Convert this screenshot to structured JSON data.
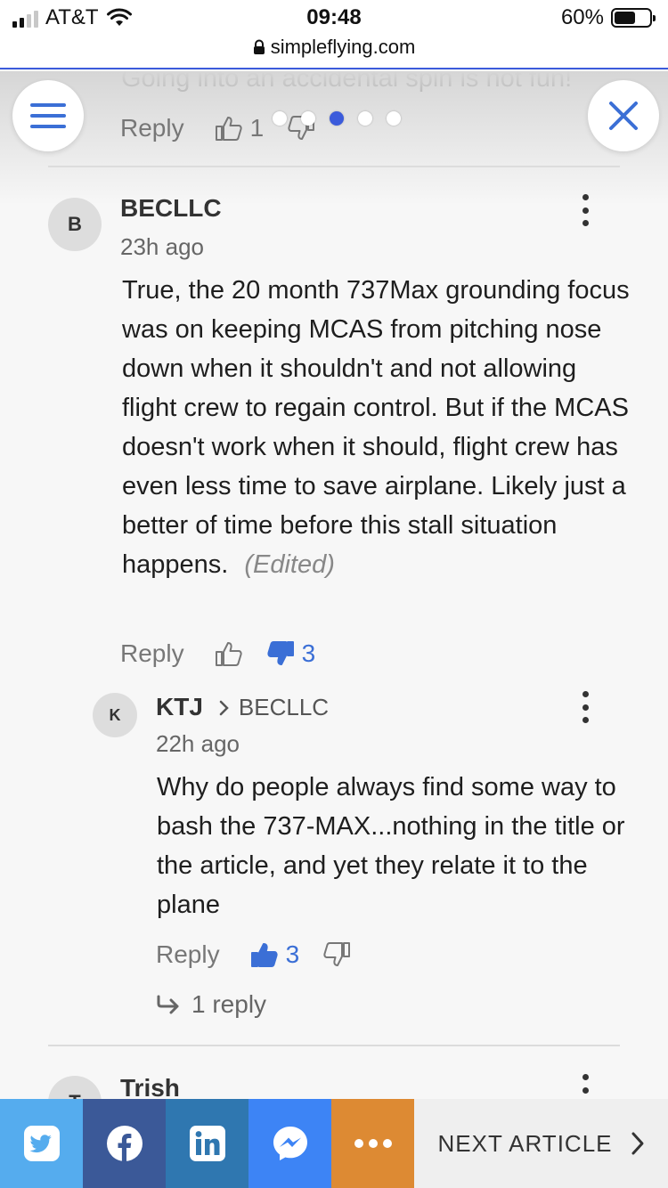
{
  "status_bar": {
    "carrier": "AT&T",
    "time": "09:48",
    "battery": "60%",
    "battery_level": 0.6,
    "url": "simpleflying.com"
  },
  "previous_comment": {
    "text_fragment": "Going into an accidental spin is not fun!",
    "reply_label": "Reply",
    "upvotes": "1"
  },
  "carousel": {
    "count": 5,
    "active_index": 2
  },
  "comments": [
    {
      "avatar_letter": "B",
      "author": "BECLLC",
      "time": "23h ago",
      "body": "True, the 20 month 737Max grounding focus was on keeping MCAS from pitching nose down when it shouldn't and not allowing flight crew to regain control.  But if the MCAS doesn't work when it should, flight crew has even less time to save airplane.  Likely just a better of time before this stall situation happens.",
      "edited": "(Edited)",
      "reply_label": "Reply",
      "downvotes": "3"
    },
    {
      "avatar_letter": "K",
      "author": "KTJ",
      "in_reply_to": "BECLLC",
      "time": "22h ago",
      "body": "Why do people always find some way to bash the 737-MAX...nothing in the title or the article, and yet they relate it to the plane",
      "reply_label": "Reply",
      "upvotes": "3",
      "replies": "1 reply"
    },
    {
      "avatar_letter": "T",
      "author": "Trish"
    }
  ],
  "share_bar": {
    "buttons": [
      {
        "name": "twitter",
        "color": "#55acee"
      },
      {
        "name": "facebook",
        "color": "#3b5998"
      },
      {
        "name": "linkedin",
        "color": "#2f77b0"
      },
      {
        "name": "messenger",
        "color": "#3d84f5"
      },
      {
        "name": "more",
        "color": "#dd8a33"
      }
    ],
    "next_article": "NEXT ARTICLE"
  },
  "colors": {
    "accent": "#3b6fd6",
    "header_border": "#3b5bdb"
  }
}
